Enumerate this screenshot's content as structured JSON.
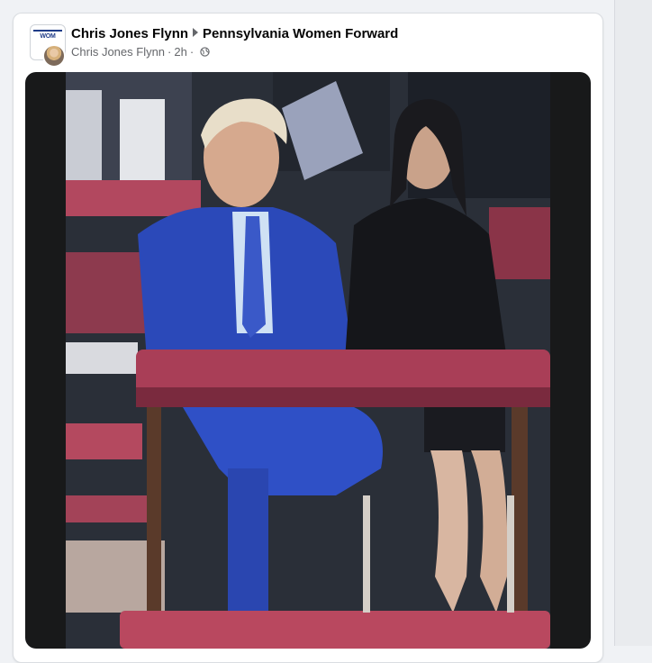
{
  "post": {
    "author": "Chris Jones Flynn",
    "group": "Pennsylvania Women Forward",
    "sub_author": "Chris Jones Flynn",
    "time": "2h",
    "separator": "·",
    "privacy_icon": "globe-icon",
    "group_logo_text": "WOM"
  },
  "colors": {
    "card_bg": "#ffffff",
    "page_bg": "#f0f2f5",
    "name_text": "#050505",
    "meta_text": "#65676b"
  }
}
